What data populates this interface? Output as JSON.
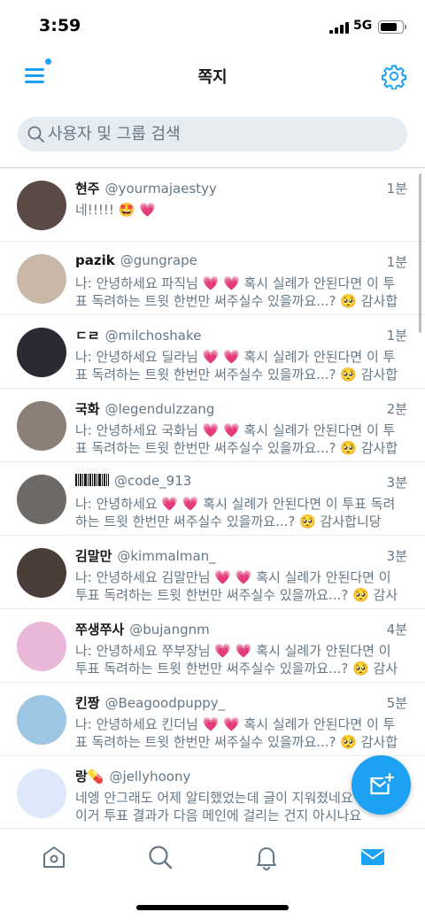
{
  "status_bar": {
    "time": "3:59",
    "network": "5G"
  },
  "header": {
    "title": "쪽지"
  },
  "search": {
    "placeholder": "사용자 및 그룹 검색"
  },
  "conversations": [
    {
      "name": "현주",
      "handle": "@yourmajaestyy",
      "time": "1분",
      "preview": "네!!!!! 🤩 💗",
      "avatar_color": "#5a4a45"
    },
    {
      "name": "pazik",
      "handle": "@gungrape",
      "time": "1분",
      "preview": "나: 안녕하세요 파직님 💗 💗 혹시 실례가 안된다면 이 투표 독려하는 트윗 한번만 써주실수 있을까요...? 🥺 감사합",
      "avatar_color": "#c9b8a8"
    },
    {
      "name": "ㄷㄹ",
      "handle": "@milchoshake",
      "time": "1분",
      "preview": "나: 안녕하세요 딜라님 💗 💗 혹시 실례가 안된다면 이 투표 독려하는 트윗 한번만 써주실수 있을까요...? 🥺 감사합",
      "avatar_color": "#2a2a33"
    },
    {
      "name": "국화",
      "handle": "@legendulzzang",
      "time": "2분",
      "preview": "나: 안녕하세요 국화님 💗 💗 혹시 실례가 안된다면 이 투표 독려하는 트윗 한번만 써주실수 있을까요...? 🥺 감사합",
      "avatar_color": "#8c7f77"
    },
    {
      "name": "",
      "handle": "@code_913",
      "time": "3분",
      "preview": "나: 안녕하세요 💗 💗 혹시 실례가 안된다면 이 투표 독려하는 트윗 한번만 써주실수 있을까요...? 🥺 감사합니당",
      "avatar_color": "#6d6a68"
    },
    {
      "name": "김말만",
      "handle": "@kimmalman_",
      "time": "3분",
      "preview": "나: 안녕하세요 김말만님 💗 💗 혹시 실례가 안된다면 이 투표 독려하는 트윗 한번만 써주실수 있을까요...? 🥺 감사",
      "avatar_color": "#4b3d38"
    },
    {
      "name": "쭈생쭈사",
      "handle": "@bujangnm",
      "time": "4분",
      "preview": "나: 안녕하세요 쭈부장님 💗 💗 혹시 실례가 안된다면 이 투표 독려하는 트윗 한번만 써주실수 있을까요...? 🥺 감사",
      "avatar_color": "#e9b8d8"
    },
    {
      "name": "킨짱",
      "handle": "@Beagoodpuppy_",
      "time": "5분",
      "preview": "나: 안녕하세요 킨더님 💗 💗 혹시 실례가 안된다면 이 투표 독려하는 트윗 한번만 써주실수 있을까요...? 🥺 감사합",
      "avatar_color": "#9cc6e4"
    },
    {
      "name": "랑💊",
      "handle": "@jellyhoony",
      "time": "",
      "preview": "네엥 안그래도 어제 알티했었는데 글이 지워졌네요 호옥시 이거 투표 결과가 다음 메인에 걸리는 건지 아시나요",
      "avatar_color": "#dde9fb"
    }
  ],
  "tabs": [
    "home-icon",
    "search-icon",
    "bell-icon",
    "mail-icon"
  ],
  "colors": {
    "accent": "#1da1f2",
    "muted": "#657786"
  }
}
